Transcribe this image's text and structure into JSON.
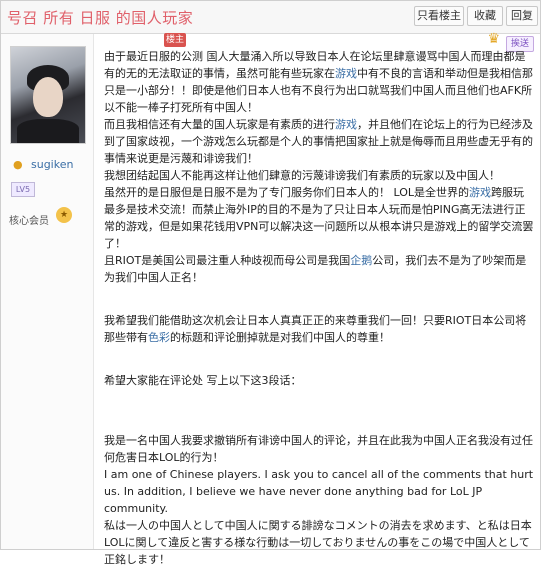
{
  "header": {
    "title": "号召 所有 日服 的国人玩家",
    "buttons": {
      "only_op": "只看楼主",
      "favorite": "收藏",
      "reply": "回复"
    }
  },
  "user": {
    "name": "sugiken",
    "level": "LV5",
    "member_label": "核心会员",
    "icons": [
      "user-icon",
      "level-badge",
      "member-medal-icon"
    ]
  },
  "post": {
    "corner_tag": "楼主",
    "share_label": "挨送",
    "crown_icon": "crown-icon",
    "p1_a": "由于最近日服的公测 国人大量涌入所以导致日本人在论坛里肆意谩骂中国人而理由都是有的无的无法取证的事情，虽然可能有些玩家在",
    "p1_hl": "游戏",
    "p1_b": "中有不良的言语和举动但是我相信那只是一小部分！！即使是他们日本人也有不良行为出口就骂我们中国人而且他们也AFK所以不能一棒子打死所有中国人！",
    "p2_a": "而且我相信还有大量的国人玩家是有素质的进行",
    "p2_hl": "游戏",
    "p2_b": "，并且他们在论坛上的行为已经涉及到了国家歧视，一个游戏怎么玩都是个人的事情把国家扯上就是侮辱而且用些虚无乎有的事情来说更是污蔑和诽谤我们！",
    "p3": "我想团结起国人不能再这样让他们肆意的污蔑诽谤我们有素质的玩家以及中国人！",
    "p4_a": "虽然开的是日服但是日服不是为了专门服务你们日本人的！ LOL是全世界的",
    "p4_hl": "游戏",
    "p4_b": "跨服玩最多是技术交流！而禁止海外IP的目的不是为了只让日本人玩而是怕PING高无法进行正常的游戏，但是如果花钱用VPN可以解决这一问题所以从根本讲只是游戏上的留学交流罢了！",
    "p5_a": "且RIOT是美国公司最注重人种歧视而母公司是我国",
    "p5_hl": "企鹅",
    "p5_b": "公司，我们去不是为了吵架而是为我们中国人正名！",
    "p6_a": "我希望我们能借助这次机会让日本人真真正正的来尊重我们一回！只要RIOT日本公司将那些带有",
    "p6_hl": "色彩",
    "p6_b": "的标题和评论删掉就是对我们中国人的尊重！",
    "p7": "希望大家能在评论处 写上以下这3段话：",
    "p8": "我是一名中国人我要求撤销所有诽谤中国人的评论，并且在此我为中国人正名我没有过任何危害日本LOL的行为！",
    "p9": "I am one of Chinese players. I ask you to cancel all of the comments that hurt us. In addition, I believe we have never done anything bad for LoL JP community.",
    "p10": "私は一人の中国人として中国人に関する誹謗なコメントの消去を求めます、と私は日本LOLに関して違反と害する様な行動は一切しておりませんの事をこの場で中国人として正銘します！"
  }
}
